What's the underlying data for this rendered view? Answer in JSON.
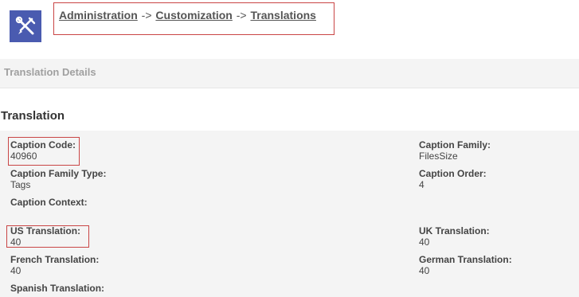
{
  "header": {
    "icon": "tools-icon",
    "breadcrumb": {
      "items": [
        "Administration",
        "Customization",
        "Translations"
      ],
      "separator": "->"
    }
  },
  "details_band": {
    "label": "Translation Details"
  },
  "section": {
    "title": "Translation"
  },
  "fields": {
    "caption_code": {
      "label": "Caption Code:",
      "value": "40960"
    },
    "caption_family": {
      "label": "Caption Family:",
      "value": "FilesSize"
    },
    "caption_family_type": {
      "label": "Caption Family Type:",
      "value": "Tags"
    },
    "caption_order": {
      "label": "Caption Order:",
      "value": "4"
    },
    "caption_context": {
      "label": "Caption Context:",
      "value": ""
    },
    "us_translation": {
      "label": "US Translation:",
      "value": "40"
    },
    "uk_translation": {
      "label": "UK Translation:",
      "value": "40"
    },
    "french_translation": {
      "label": "French Translation:",
      "value": "40"
    },
    "german_translation": {
      "label": "German Translation:",
      "value": "40"
    },
    "spanish_translation": {
      "label": "Spanish Translation:",
      "value": ""
    }
  },
  "colors": {
    "icon_bg": "#4a5bb0",
    "highlight": "#c94545",
    "panel_bg": "#f4f4f4"
  }
}
